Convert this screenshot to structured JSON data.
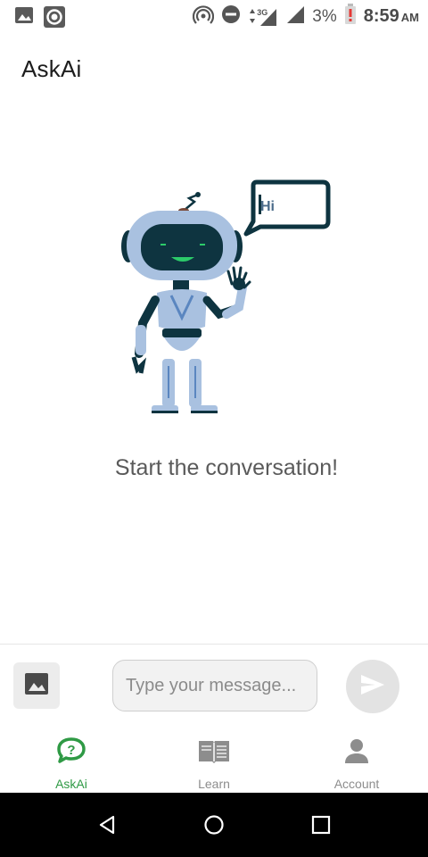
{
  "status_bar": {
    "network_type": "3G",
    "battery_percent": "3%",
    "time": "8:59",
    "ampm": "AM",
    "icons": [
      "image-icon",
      "record-icon",
      "hotspot-icon",
      "do-not-disturb-icon",
      "signal-icon",
      "signal-icon",
      "battery-alert-icon"
    ]
  },
  "app_bar": {
    "title": "AskAi"
  },
  "empty_state": {
    "message": "Start the conversation!",
    "bubble_text": "Hi"
  },
  "composer": {
    "placeholder": "Type your message...",
    "value": "",
    "image_button_icon": "image-icon",
    "send_button_icon": "send-icon"
  },
  "bottom_nav": {
    "items": [
      {
        "label": "AskAi",
        "icon": "question-chat-icon",
        "active": true
      },
      {
        "label": "Learn",
        "icon": "book-icon",
        "active": false
      },
      {
        "label": "Account",
        "icon": "person-icon",
        "active": false
      }
    ]
  },
  "system_nav": {
    "icons": [
      "back-icon",
      "home-icon",
      "recents-icon"
    ]
  },
  "colors": {
    "accent": "#2f9a45",
    "inactive": "#8d8d8d",
    "robot_dark": "#0e3440",
    "robot_light": "#a9c1e0",
    "robot_mouth": "#2ccb6a"
  }
}
